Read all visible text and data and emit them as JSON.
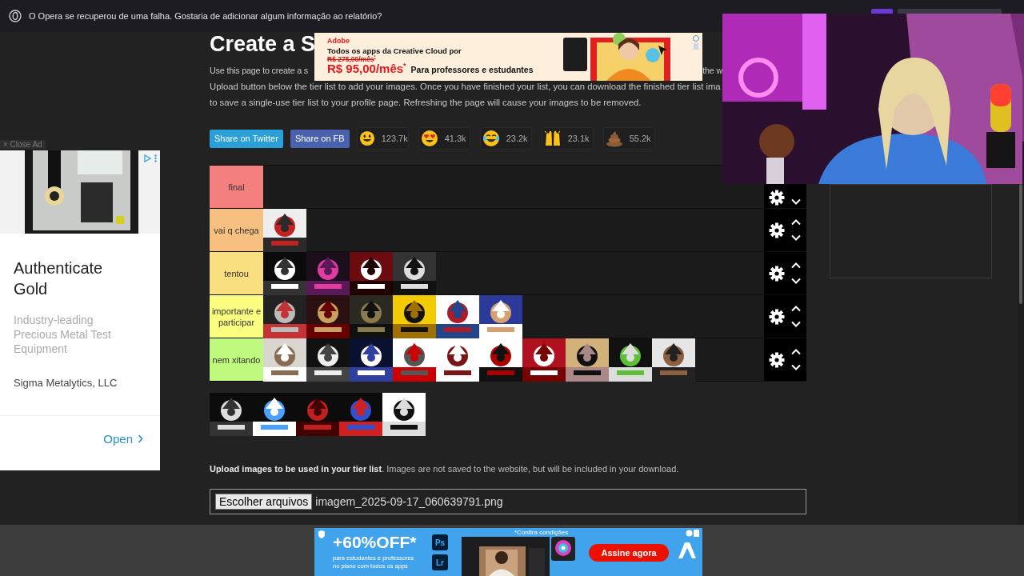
{
  "browser_bar": {
    "message": "O Opera se recuperou de uma falha. Gostaria de adicionar algum informação ao relatório?"
  },
  "page": {
    "title": "Create a S",
    "intro": [
      [
        "Use this page to create a s",
        "the w"
      ],
      [
        "Upload button below the tier list to add your images. Once you have finished your list, you can download the finished tier list ima"
      ],
      [
        "to save a single-use tier list to your profile page. Refreshing the page will cause your images to be removed."
      ]
    ]
  },
  "share_buttons": [
    {
      "label": "Share on Twitter",
      "kind": "twitter"
    },
    {
      "label": "Share on FB",
      "kind": "facebook"
    }
  ],
  "reactions": [
    {
      "kind": "smile",
      "count": "123.7k"
    },
    {
      "kind": "heart_eyes",
      "count": "41.3k"
    },
    {
      "kind": "joy",
      "count": "23.2k"
    },
    {
      "kind": "raised_hands",
      "count": "23.1k"
    },
    {
      "kind": "poop",
      "count": "55.2k"
    }
  ],
  "tiers": [
    {
      "label": "final",
      "color": "#f47f7f"
    },
    {
      "label": "vai q chega",
      "color": "#f7bf80"
    },
    {
      "label": "tentou",
      "color": "#f9df80"
    },
    {
      "label": "importante e participar",
      "color": "#fbfd80"
    },
    {
      "label": "nem xitando",
      "color": "#bff97e"
    }
  ],
  "upload": {
    "text": "**Upload images to be used in your tier list**. Images are not saved to the website, but will be included in your download.",
    "button": "Escolher arquivos",
    "file": "imagem_2025-09-17_060639791.png"
  },
  "side_ad": {
    "close": "× Close Ad",
    "title": "Authenticate Gold",
    "description": "Industry-leading Precious Metal Test Equipment",
    "advertiser": "Sigma Metalytics, LLC",
    "action": "Open"
  },
  "top_ad": {
    "brand": "Adobe",
    "headline": "Todos os apps da Creative Cloud por",
    "old_price": "R$ 275,00/mês$^{*}$",
    "price": "R$ 95,00/mês$^{*}$",
    "audience": "Para professores e estudantes"
  },
  "bottom_ad": {
    "headline": "+60%OFF*",
    "subline": "para estudantes e professores no plano com todos os apps",
    "apps": [
      "Ps",
      "Lr"
    ],
    "note": "*Confira condições",
    "action": "Assine agora"
  }
}
